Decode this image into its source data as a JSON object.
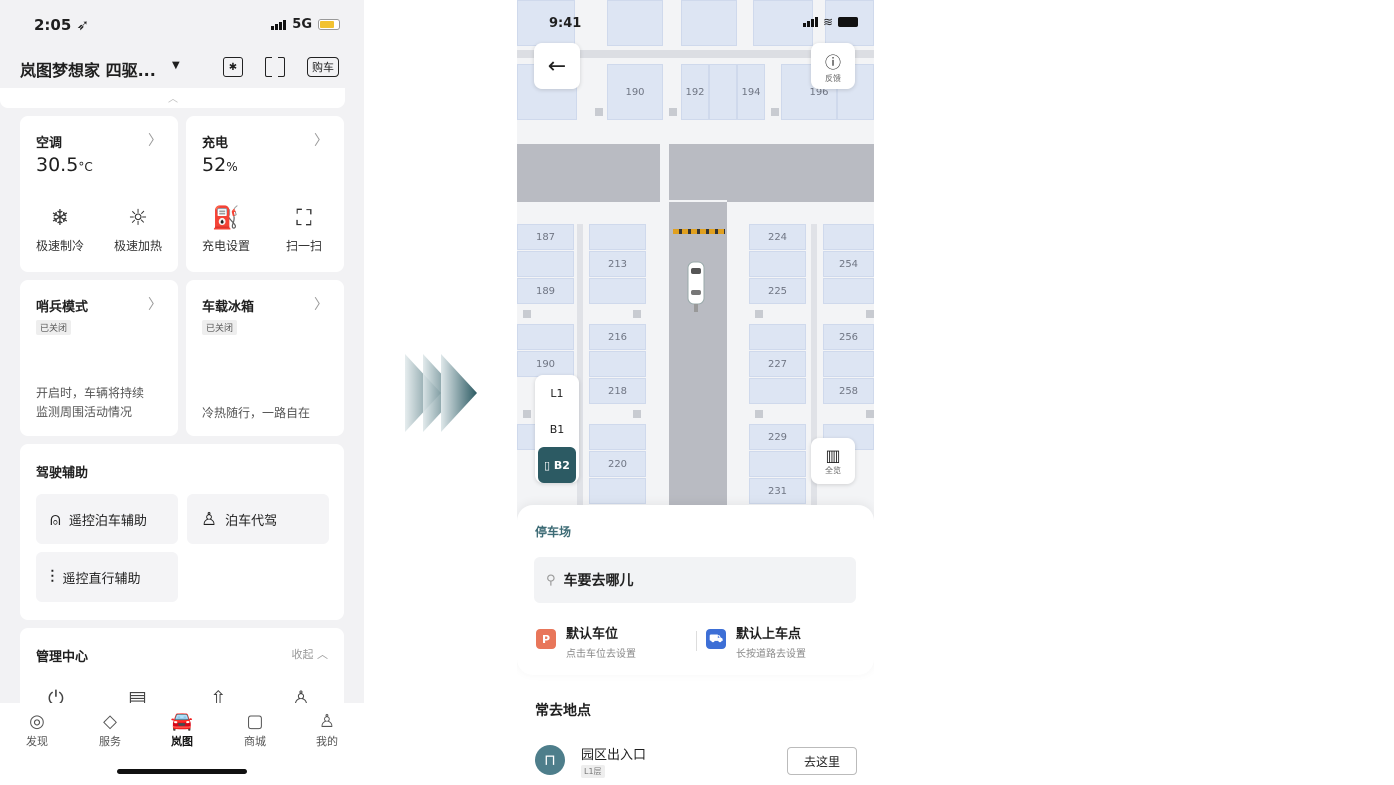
{
  "left": {
    "status": {
      "time": "2:05",
      "network": "5G"
    },
    "vehicle_name": "岚图梦想家 四驱...",
    "buy_label": "购车",
    "ac": {
      "title": "空调",
      "temp": "30.5",
      "unit": "°C",
      "btn1": "极速制冷",
      "btn2": "极速加热"
    },
    "charge": {
      "title": "充电",
      "percent": "52",
      "unit": "%",
      "btn1": "充电设置",
      "btn2": "扫一扫"
    },
    "sentry": {
      "title": "哨兵模式",
      "status": "已关闭",
      "desc1": "开启时，车辆将持续",
      "desc2": "监测周围活动情况"
    },
    "fridge": {
      "title": "车载冰箱",
      "status": "已关闭",
      "desc": "冷热随行，一路自在"
    },
    "driving": {
      "title": "驾驶辅助",
      "btn1": "遥控泊车辅助",
      "btn2": "泊车代驾",
      "btn3": "遥控直行辅助"
    },
    "mgmt": {
      "title": "管理中心",
      "collapse": "收起"
    },
    "tabs": [
      "发现",
      "服务",
      "岚图",
      "商城",
      "我的"
    ]
  },
  "right": {
    "status": {
      "time": "9:41"
    },
    "feedback": "反馈",
    "overview": "全览",
    "floors": [
      "L1",
      "B1",
      "B2"
    ],
    "slots": {
      "top": [
        "190",
        "192",
        "194",
        "196"
      ],
      "left_col": [
        "187",
        "189",
        "190"
      ],
      "mid_col": [
        "213",
        "216",
        "218",
        "220"
      ],
      "r1_col": [
        "224",
        "225",
        "227",
        "229",
        "231"
      ],
      "r2_col": [
        "254",
        "256",
        "258"
      ]
    },
    "sheet": {
      "title": "停车场",
      "search_placeholder": "车要去哪儿",
      "opt1_title": "默认车位",
      "opt1_sub": "点击车位去设置",
      "opt2_title": "默认上车点",
      "opt2_sub": "长按道路去设置"
    },
    "frequent": {
      "title": "常去地点",
      "place_name": "园区出入口",
      "place_floor": "L1层",
      "go_label": "去这里"
    }
  },
  "colors": {
    "accent": "#2c5a63",
    "parking_icon": "#e8765a",
    "pickup_icon": "#3d6fd6"
  }
}
